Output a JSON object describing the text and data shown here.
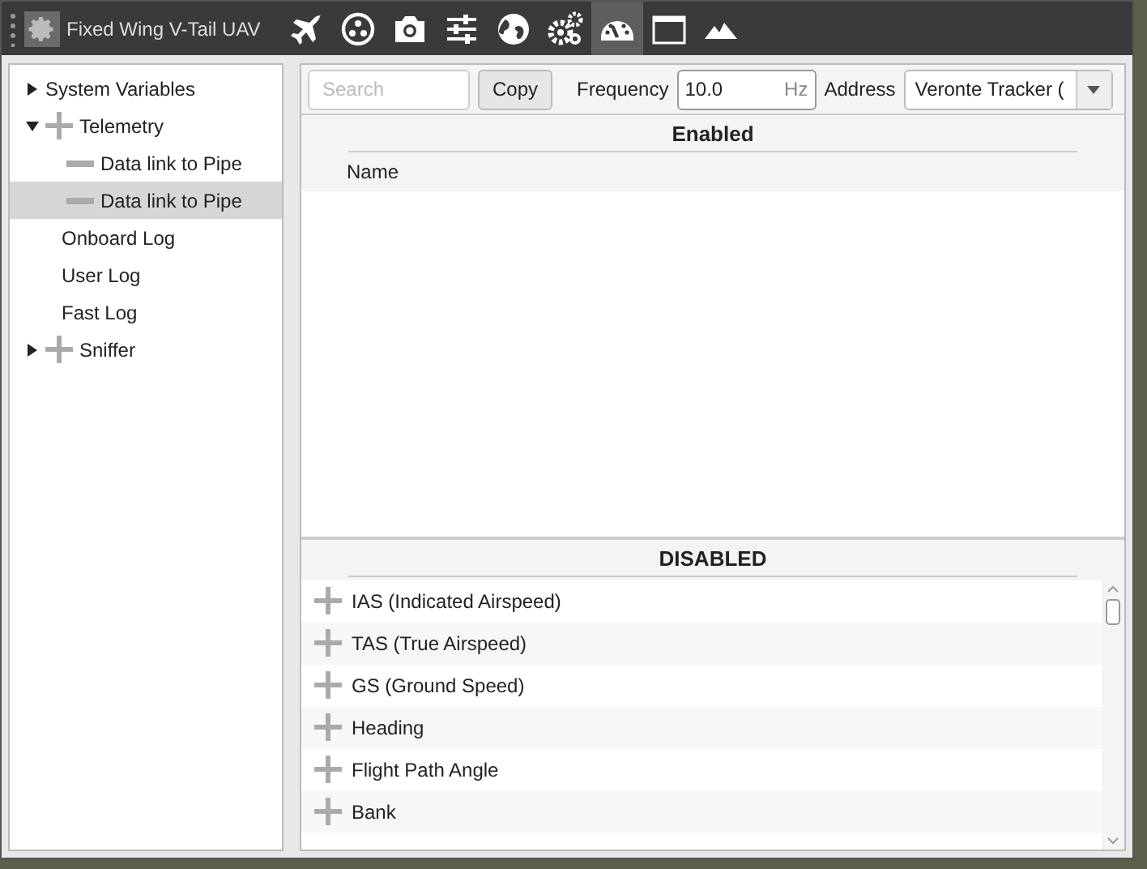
{
  "window": {
    "title": "Fixed Wing V-Tail UAV"
  },
  "toolbar": [
    {
      "kind": "plane",
      "selected": false
    },
    {
      "kind": "dots",
      "selected": false
    },
    {
      "kind": "camera",
      "selected": false
    },
    {
      "kind": "sliders",
      "selected": false
    },
    {
      "kind": "globe",
      "selected": false
    },
    {
      "kind": "gears",
      "selected": false
    },
    {
      "kind": "gauge",
      "selected": true
    },
    {
      "kind": "window",
      "selected": false
    },
    {
      "kind": "mountains",
      "selected": false
    }
  ],
  "tree": [
    {
      "label": "System Variables",
      "kind": "plain",
      "expanded": false,
      "selected": false
    },
    {
      "label": "Telemetry",
      "kind": "plus",
      "expanded": true,
      "selected": false,
      "children": [
        {
          "label": "Data link to Pipe",
          "kind": "minus",
          "selected": false
        },
        {
          "label": "Data link to Pipe",
          "kind": "minus",
          "selected": true
        }
      ]
    },
    {
      "label": "Onboard Log",
      "kind": "leaf",
      "selected": false
    },
    {
      "label": "User Log",
      "kind": "leaf",
      "selected": false
    },
    {
      "label": "Fast Log",
      "kind": "leaf",
      "selected": false
    },
    {
      "label": "Sniffer",
      "kind": "plus",
      "expanded": false,
      "selected": false
    }
  ],
  "controls": {
    "search": {
      "placeholder": "Search"
    },
    "copy_button": "Copy",
    "frequency_label": "Frequency",
    "frequency": {
      "value": "10.0",
      "unit": "Hz"
    },
    "address_label": "Address",
    "address": {
      "value": "Veronte Tracker ("
    }
  },
  "enabled": {
    "title": "Enabled",
    "columns": [
      "Name"
    ]
  },
  "disabled": {
    "title": "DISABLED",
    "items": [
      "IAS (Indicated Airspeed)",
      "TAS (True Airspeed)",
      "GS (Ground Speed)",
      "Heading",
      "Flight Path Angle",
      "Bank"
    ]
  }
}
